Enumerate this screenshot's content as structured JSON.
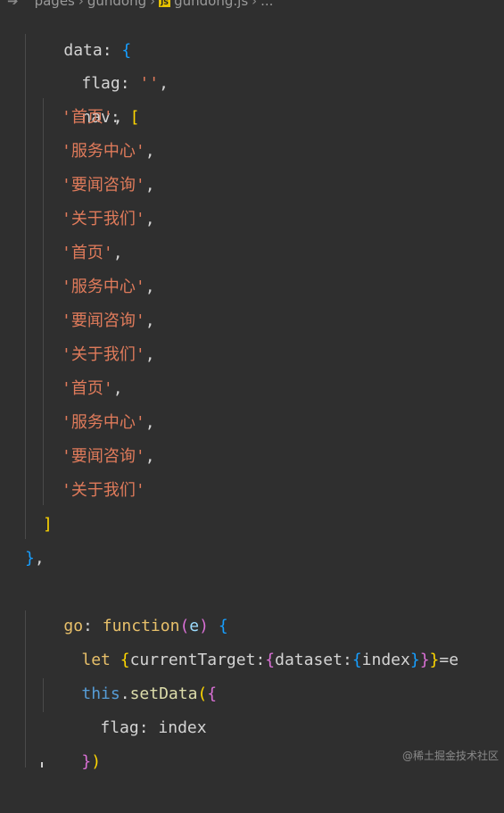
{
  "breadcrumb": {
    "items": [
      "pages",
      "gundong",
      "gundong.js",
      "..."
    ]
  },
  "code": {
    "lines": [
      {
        "id": "l0",
        "parts": [
          "data",
          ": ",
          "{"
        ]
      },
      {
        "id": "l1",
        "parts": [
          "flag",
          ": ",
          "''",
          ","
        ]
      },
      {
        "id": "l2",
        "parts": [
          "nav",
          ": ",
          "["
        ]
      },
      {
        "id": "l3",
        "parts": [
          "'首页'",
          ","
        ]
      },
      {
        "id": "l4",
        "parts": [
          "'服务中心'",
          ","
        ]
      },
      {
        "id": "l5",
        "parts": [
          "'要闻咨询'",
          ","
        ]
      },
      {
        "id": "l6",
        "parts": [
          "'关于我们'",
          ","
        ]
      },
      {
        "id": "l7",
        "parts": [
          "'首页'",
          ","
        ]
      },
      {
        "id": "l8",
        "parts": [
          "'服务中心'",
          ","
        ]
      },
      {
        "id": "l9",
        "parts": [
          "'要闻咨询'",
          ","
        ]
      },
      {
        "id": "l10",
        "parts": [
          "'关于我们'",
          ","
        ]
      },
      {
        "id": "l11",
        "parts": [
          "'首页'",
          ","
        ]
      },
      {
        "id": "l12",
        "parts": [
          "'服务中心'",
          ","
        ]
      },
      {
        "id": "l13",
        "parts": [
          "'要闻咨询'",
          ","
        ]
      },
      {
        "id": "l14",
        "parts": [
          "'关于我们'"
        ]
      },
      {
        "id": "l15",
        "parts": [
          "]"
        ]
      },
      {
        "id": "l16",
        "parts": [
          "}",
          ","
        ]
      },
      {
        "id": "l17",
        "parts": [
          "go",
          ": ",
          "function",
          "(",
          "e",
          ") ",
          "{"
        ]
      },
      {
        "id": "l18",
        "parts": [
          "let ",
          "{",
          "currentTarget:",
          "{",
          "dataset:",
          "{",
          "index",
          "}",
          "}",
          "}",
          "=e"
        ]
      },
      {
        "id": "l19",
        "parts": [
          "this",
          ".",
          "setData",
          "(",
          "{"
        ]
      },
      {
        "id": "l20",
        "parts": [
          "flag",
          ": ",
          "index"
        ]
      },
      {
        "id": "l21",
        "parts": [
          "}",
          ")"
        ]
      }
    ]
  },
  "watermark": "@稀土掘金技术社区"
}
